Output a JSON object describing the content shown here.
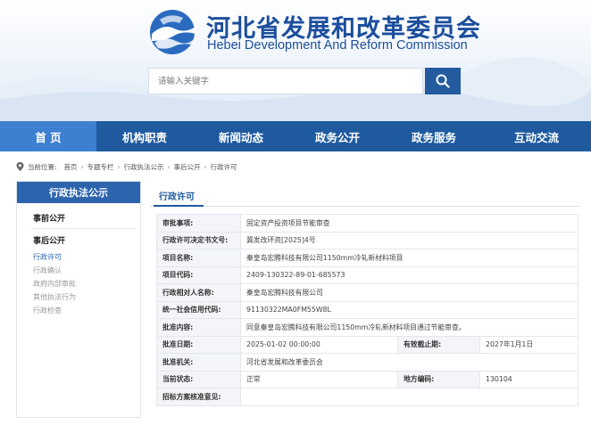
{
  "header": {
    "title_cn": "河北省发展和改革委员会",
    "title_en": "Hebei Development And Reform Commission",
    "search_placeholder": "请输入关键字"
  },
  "nav": [
    "首 页",
    "机构职责",
    "新闻动态",
    "政务公开",
    "政务服务",
    "互动交流"
  ],
  "breadcrumb": {
    "prefix": "当前位置:",
    "items": [
      "首页",
      "专题专栏",
      "行政执法公示",
      "事后公开",
      "行政许可"
    ]
  },
  "sidebar": {
    "header": "行政执法公示",
    "group1": "事前公开",
    "group2": "事后公开",
    "items": [
      "行政许可",
      "行政确认",
      "政府内部审批",
      "其他执法行为",
      "行政检查"
    ]
  },
  "main": {
    "title": "行政许可",
    "rows": [
      {
        "label": "审批事项:",
        "value": "固定资产投资项目节能审查"
      },
      {
        "label": "行政许可决定书文号:",
        "value": "冀发改环资[2025]4号"
      },
      {
        "label": "项目名称:",
        "value": "秦皇岛宏腾科技有限公司1150mm冷轧新材料项目"
      },
      {
        "label": "项目代码:",
        "value": "2409-130322-89-01-685573"
      },
      {
        "label": "行政相对人名称:",
        "value": "秦皇岛宏腾科技有限公司"
      },
      {
        "label": "统一社会信用代码:",
        "value": "91130322MA0FM55W8L"
      },
      {
        "label": "批准内容:",
        "value": "同意秦皇岛宏腾科技有限公司1150mm冷轧新材料项目通过节能审查。"
      }
    ],
    "date_row": {
      "label": "批准日期:",
      "value": "2025-01-02 00:00:00",
      "label2": "有效截止期:",
      "value2": "2027年1月1日"
    },
    "org_row": {
      "label": "批准机关:",
      "value": "河北省发展和改革委员会"
    },
    "status_row": {
      "label": "当前状态:",
      "value": "正常",
      "label2": "地方编码:",
      "value2": "130104"
    },
    "last_row": {
      "label": "招标方案核准意见:",
      "value": ""
    }
  },
  "colors": {
    "primary": "#1f5a9f",
    "nav_active": "#3d7fd0",
    "sidebar_head": "#2c64ad"
  }
}
